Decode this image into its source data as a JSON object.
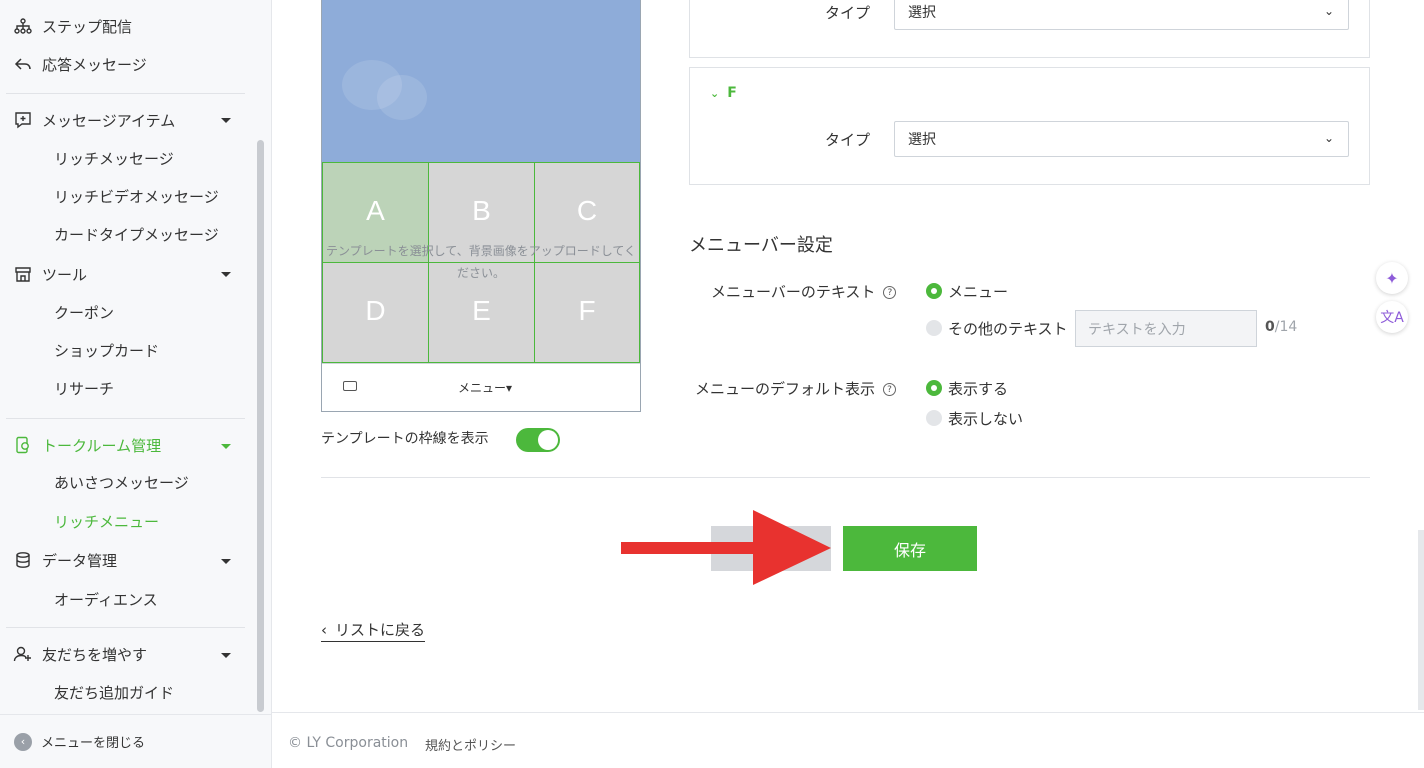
{
  "sidebar": {
    "items": [
      {
        "label": "ステップ配信",
        "icon": "hierarchy-icon"
      },
      {
        "label": "応答メッセージ",
        "icon": "reply-icon"
      },
      {
        "label": "メッセージアイテム",
        "icon": "message-plus-icon"
      },
      {
        "label": "ツール",
        "icon": "shop-icon"
      },
      {
        "label": "トークルーム管理",
        "icon": "phone-chat-icon"
      },
      {
        "label": "データ管理",
        "icon": "database-icon"
      },
      {
        "label": "友だちを増やす",
        "icon": "add-user-icon"
      }
    ],
    "subitems": {
      "rich_message": "リッチメッセージ",
      "rich_video": "リッチビデオメッセージ",
      "card_type": "カードタイプメッセージ",
      "coupon": "クーポン",
      "shop_card": "ショップカード",
      "research": "リサーチ",
      "greeting": "あいさつメッセージ",
      "rich_menu": "リッチメニュー",
      "audience": "オーディエンス",
      "friend_guide": "友だち追加ガイド"
    },
    "collapse_label": "メニューを閉じる"
  },
  "preview": {
    "cells": [
      "A",
      "B",
      "C",
      "D",
      "E",
      "F"
    ],
    "hint": "テンプレートを選択して、背景画像をアップロードしてください。",
    "chatbar_menu": "メニュー▾"
  },
  "template_border": {
    "label": "テンプレートの枠線を表示",
    "on": true
  },
  "areas": {
    "e_type_label": "タイプ",
    "e_type_value": "選択",
    "f_title": "F",
    "f_type_label": "タイプ",
    "f_type_value": "選択"
  },
  "menubar": {
    "title": "メニューバー設定",
    "text_label": "メニューバーのテキスト",
    "option_menu": "メニュー",
    "option_other": "その他のテキスト",
    "other_placeholder": "テキストを入力",
    "count_current": "0",
    "count_max": "/14",
    "default_label": "メニューのデフォルト表示",
    "show": "表示する",
    "hide": "表示しない"
  },
  "actions": {
    "save": "保存"
  },
  "back_link": "リストに戻る",
  "footer": {
    "copyright": "© LY Corporation",
    "policy": "規約とポリシー"
  },
  "colors": {
    "accent": "#4cb83c",
    "arrow": "#e8322f"
  }
}
